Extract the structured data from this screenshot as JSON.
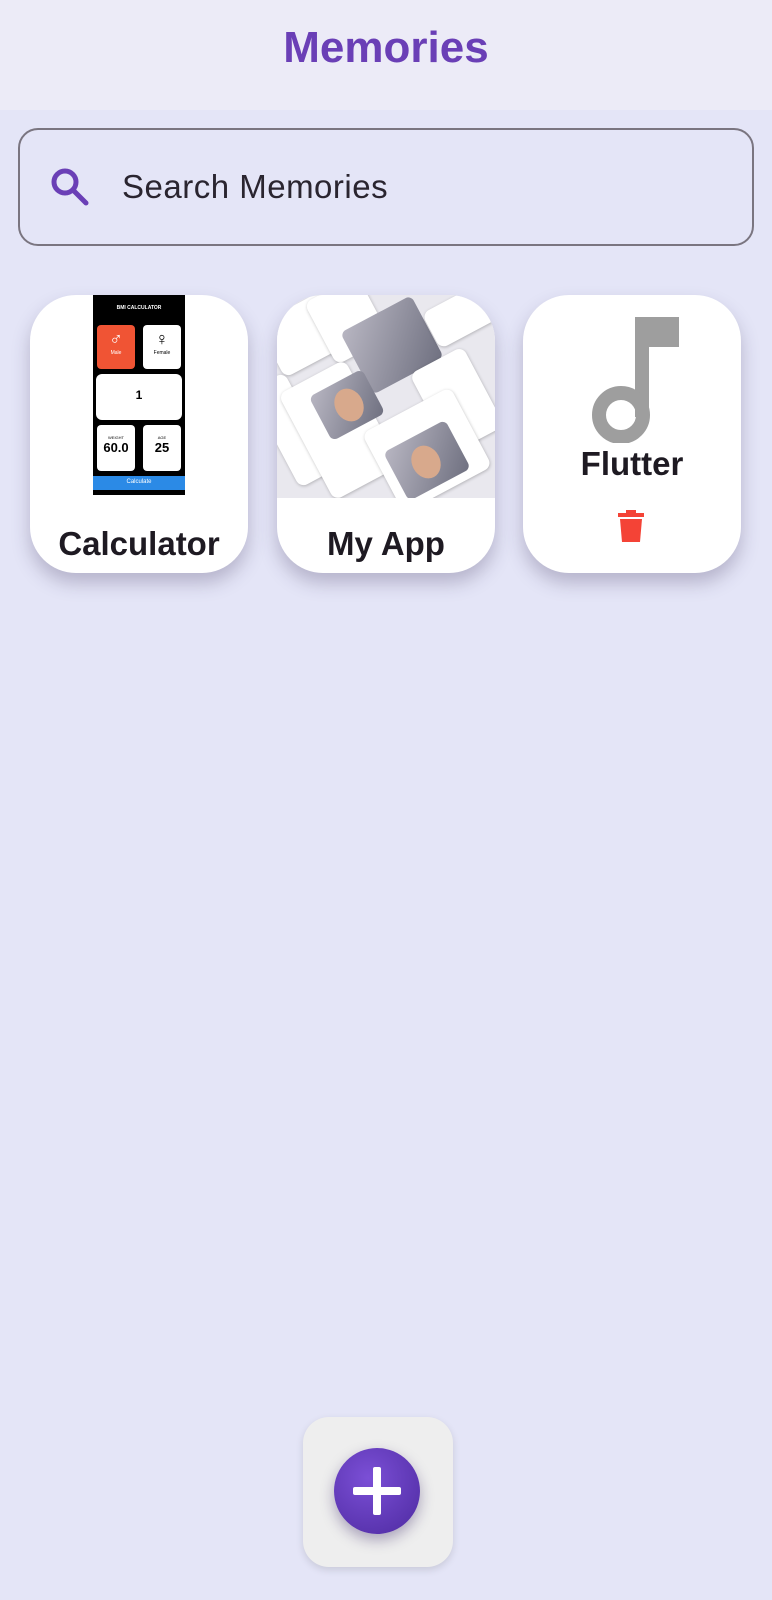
{
  "app_bar": {
    "title": "Memories"
  },
  "search": {
    "placeholder": "Search Memories"
  },
  "memories": [
    {
      "label": "Calculator",
      "thumbnail": {
        "header": "BMI CALCULATOR",
        "male_label": "Male",
        "female_label": "Female",
        "height_value": "1",
        "weight_label": "WEIGHT",
        "weight_value": "60.0",
        "age_label": "AGE",
        "age_value": "25",
        "button_label": "Calculate"
      }
    },
    {
      "label": "My App"
    },
    {
      "label": "Flutter",
      "icon": "music-note-icon",
      "action_icon": "trash-icon"
    }
  ],
  "fab": {
    "icon": "plus-icon"
  },
  "colors": {
    "accent": "#6a3fb6",
    "background": "#e4e5f7",
    "delete": "#f44336",
    "icon_grey": "#9e9e9e"
  }
}
